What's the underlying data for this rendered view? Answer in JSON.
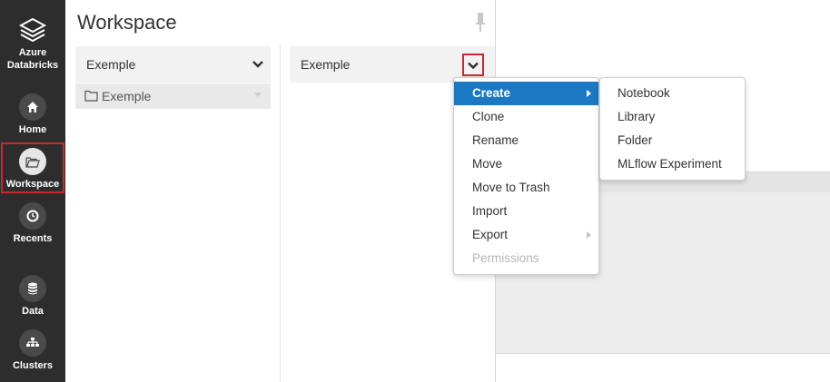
{
  "sidebar": {
    "logo_line1": "Azure",
    "logo_line2": "Databricks",
    "items": [
      {
        "label": "Home",
        "icon": "home-icon"
      },
      {
        "label": "Workspace",
        "icon": "folder-open-icon",
        "active": true
      },
      {
        "label": "Recents",
        "icon": "clock-icon"
      },
      {
        "label": "Data",
        "icon": "database-icon"
      },
      {
        "label": "Clusters",
        "icon": "clusters-icon"
      }
    ]
  },
  "panel": {
    "title": "Workspace",
    "column1": {
      "header": "Exemple",
      "rows": [
        {
          "label": "Exemple",
          "icon": "folder-icon"
        }
      ]
    },
    "column2": {
      "header": "Exemple"
    }
  },
  "context_menu": {
    "items": [
      {
        "label": "Create",
        "active": true,
        "has_submenu": true
      },
      {
        "label": "Clone"
      },
      {
        "label": "Rename"
      },
      {
        "label": "Move"
      },
      {
        "label": "Move to Trash"
      },
      {
        "label": "Import"
      },
      {
        "label": "Export",
        "has_submenu": true
      },
      {
        "label": "Permissions",
        "disabled": true
      }
    ]
  },
  "create_submenu": {
    "items": [
      {
        "label": "Notebook"
      },
      {
        "label": "Library"
      },
      {
        "label": "Folder"
      },
      {
        "label": "MLflow Experiment"
      }
    ]
  },
  "colors": {
    "sidebar_bg": "#2d2d2d",
    "highlight_red": "#d0242f",
    "menu_active_blue": "#1a79c2"
  }
}
